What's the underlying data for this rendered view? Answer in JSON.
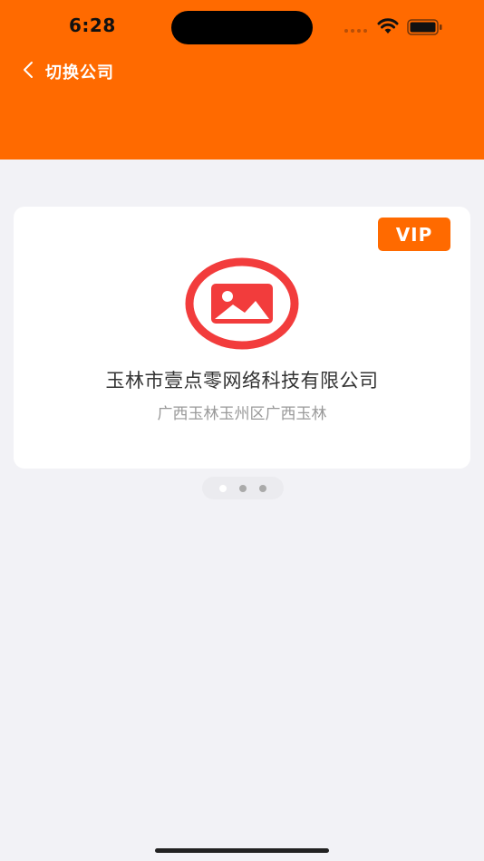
{
  "status_bar": {
    "time": "6:28"
  },
  "nav": {
    "title": "切换公司",
    "back_icon": "chevron-left-icon"
  },
  "card": {
    "badge": "VIP",
    "logo_icon": "image-icon",
    "company_name": "玉林市壹点零网络科技有限公司",
    "address": "广西玉林玉州区广西玉林"
  },
  "pager": {
    "count": 3,
    "active_index": 0
  },
  "colors": {
    "accent": "#ff6a00",
    "logo_red": "#f23c3c",
    "background": "#f2f2f6"
  }
}
